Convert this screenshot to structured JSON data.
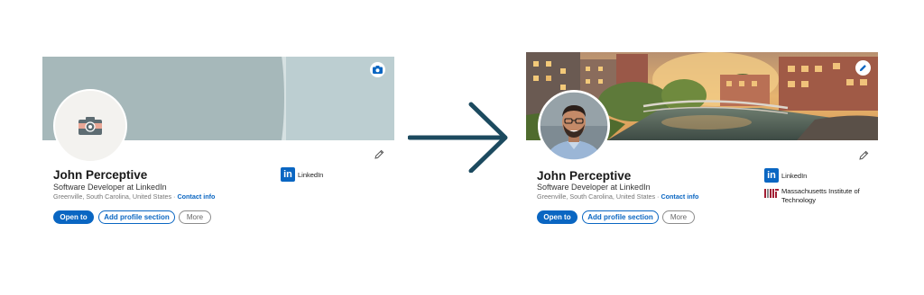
{
  "left_profile": {
    "name": "John Perceptive",
    "headline": "Software Developer at LinkedIn",
    "location": "Greenville, South Carolina, United States",
    "separator": "·",
    "contact_label": "Contact info",
    "org": "LinkedIn",
    "buttons": {
      "open_to": "Open to",
      "add_section": "Add profile section",
      "more": "More"
    }
  },
  "right_profile": {
    "name": "John Perceptive",
    "headline": "Software Developer at LinkedIn",
    "location": "Greenville, South Carolina, United States",
    "separator": "·",
    "contact_label": "Contact info",
    "orgs": [
      {
        "label": "LinkedIn",
        "logo": "linkedin-logo"
      },
      {
        "label": "Massachusetts Institute of Technology",
        "logo": "mit-logo"
      }
    ],
    "buttons": {
      "open_to": "Open to",
      "add_section": "Add profile section",
      "more": "More"
    }
  },
  "icons": {
    "camera": "camera-icon",
    "pencil": "pencil-icon",
    "arrow": "arrow-right-icon"
  },
  "colors": {
    "brand": "#0a66c2",
    "arrow": "#1c4a5f",
    "placeholder_banner": "#a9bfc2",
    "mit_red": "#a31f34"
  }
}
